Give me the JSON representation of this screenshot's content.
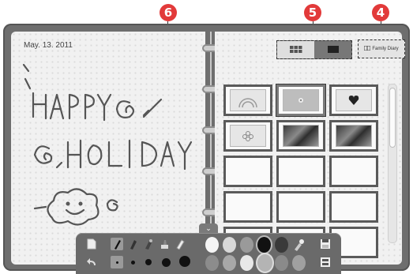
{
  "callouts": {
    "c6": "6",
    "c5": "5",
    "c4": "4"
  },
  "diary": {
    "date": "May. 13. 2011"
  },
  "header": {
    "family_diary_label": "Family Diary"
  },
  "icons": {
    "grid_view": "grid-view-icon",
    "single_view": "single-view-icon",
    "toolbar_toggle": "chevron-down-icon"
  },
  "colors": {
    "accent": "#e23a3a",
    "frame": "#6e6e6e",
    "page": "#f1f1f1"
  },
  "toolbar": {
    "brush_sizes": [
      "tiny",
      "small",
      "medium",
      "large",
      "xlarge"
    ],
    "palette_top": [
      "white",
      "light-gray",
      "gray",
      "black",
      "dark-gray",
      "brush-color"
    ],
    "palette_bottom": [
      "gray",
      "gray",
      "white",
      "gray",
      "gray",
      "gray"
    ]
  }
}
